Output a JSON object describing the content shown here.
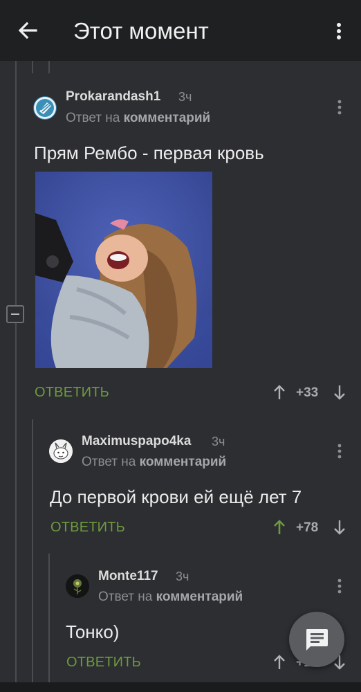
{
  "appbar": {
    "title": "Этот момент",
    "back_icon": "arrow-left-icon",
    "menu_icon": "more-vertical-icon"
  },
  "comments": [
    {
      "username": "Prokarandash1",
      "time": "3ч",
      "reply_prefix": "Ответ на",
      "reply_target": "комментарий",
      "text": "Прям Рембо - первая кровь",
      "reply_label": "ОТВЕТИТЬ",
      "score": "+33",
      "upvoted": false
    },
    {
      "username": "Maximuspapo4ka",
      "time": "3ч",
      "reply_prefix": "Ответ на",
      "reply_target": "комментарий",
      "text": "До первой крови ей ещё лет 7",
      "reply_label": "ОТВЕТИТЬ",
      "score": "+78",
      "upvoted": true
    },
    {
      "username": "Monte117",
      "time": "3ч",
      "reply_prefix": "Ответ на",
      "reply_target": "комментарий",
      "text": "Тонко)",
      "reply_label": "ОТВЕТИТЬ",
      "score": "+13",
      "upvoted": false
    }
  ],
  "colors": {
    "accent_green": "#6f9a3e",
    "upvote_green": "#6f9a3e",
    "background": "#2c2e31",
    "appbar": "#1f2022"
  },
  "fab_icon": "comment-icon"
}
